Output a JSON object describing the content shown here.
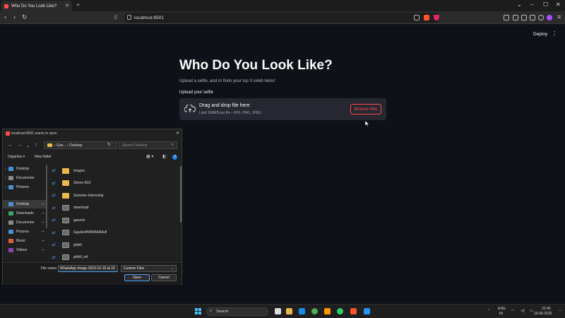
{
  "browser": {
    "tab_title": "Who Do You Look Like?",
    "new_tab": "+",
    "url": "localhost:8501"
  },
  "app": {
    "deploy_label": "Deploy",
    "title": "Who Do You Look Like?",
    "subtitle": "Upload a selfie, and AI finds your top 3 celeb twins!",
    "upload_label": "Upload your selfie",
    "dropzone_title": "Drag and drop file here",
    "dropzone_sub": "Limit 200MB per file • JPG, PNG, JPEG",
    "browse_label": "Browse files"
  },
  "dialog": {
    "title": "localhost:8501 wants to open",
    "path": "› Gan... › Desktop",
    "search_placeholder": "Search Desktop",
    "organize_label": "Organize ▾",
    "new_folder_label": "New folder",
    "nav_items": [
      {
        "label": "Desktop",
        "chevron": "›",
        "color": "#4a90d9"
      },
      {
        "label": "Documents",
        "chevron": "›",
        "color": "#8a8a8a"
      },
      {
        "label": "Pictures",
        "chevron": "›",
        "color": "#4a90d9"
      },
      {
        "label": "Desktop",
        "color": "#4a90d9",
        "pinned": true,
        "selected": true
      },
      {
        "label": "Downloads",
        "color": "#3aa76d",
        "pinned": true
      },
      {
        "label": "Documents",
        "color": "#8a8a8a",
        "pinned": true
      },
      {
        "label": "Pictures",
        "color": "#4a90d9",
        "pinned": true
      },
      {
        "label": "Music",
        "color": "#e05d44",
        "pinned": true
      },
      {
        "label": "Videos",
        "color": "#8e44ad",
        "pinned": true
      }
    ],
    "files": [
      {
        "name": "images",
        "kind": "folder"
      },
      {
        "name": "Striver A2Z",
        "kind": "folder"
      },
      {
        "name": "Summer-Internship",
        "kind": "folder"
      },
      {
        "name": "download",
        "kind": "image"
      },
      {
        "name": "ganesh",
        "kind": "image"
      },
      {
        "name": "GguAeWWW6AA9ufI",
        "kind": "image"
      },
      {
        "name": "ghibli",
        "kind": "image"
      },
      {
        "name": "ghibli_ref",
        "kind": "image"
      }
    ],
    "filename_label": "File name:",
    "filename_value": "WhatsApp Image 2023-10-19 at 22",
    "filter_value": "Custom Files",
    "open_label": "Open",
    "cancel_label": "Cancel"
  },
  "taskbar": {
    "search_label": "Search",
    "lang_line1": "ENG",
    "lang_line2": "IN",
    "time": "22:45",
    "date": "16-06-2025"
  }
}
